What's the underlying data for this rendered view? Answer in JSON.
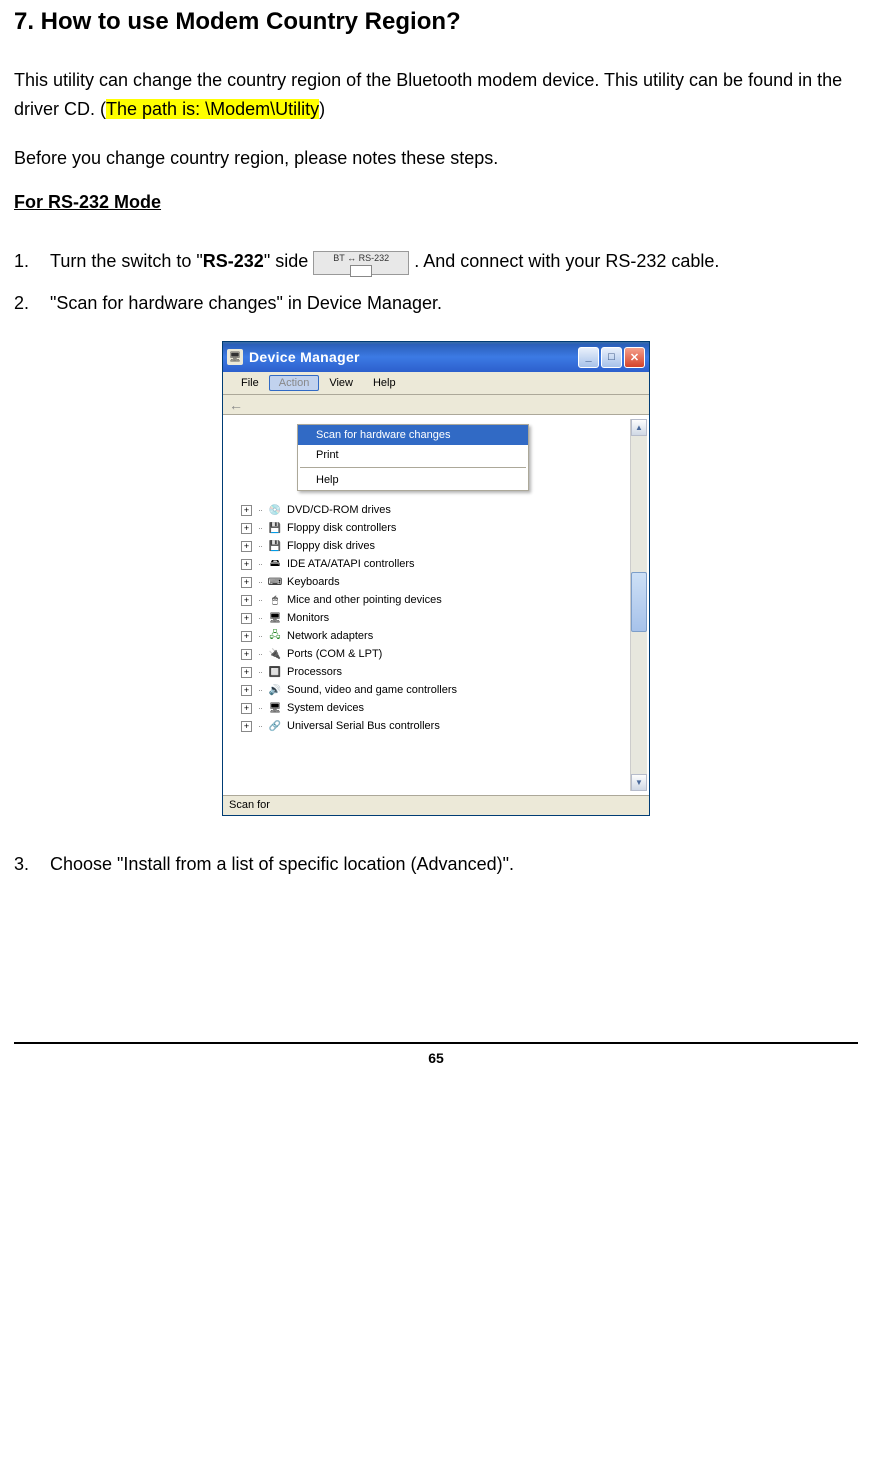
{
  "heading": "7. How to use Modem Country Region?",
  "para1_pre": "This utility can change the country region of the Bluetooth modem device. This utility can be found in the driver CD. (",
  "para1_hl": "The path is: \\Modem\\Utility",
  "para1_post": ")",
  "para2": "Before you change country region, please notes these steps.",
  "subheading": "For RS-232 Mode",
  "step1_a": "Turn the switch to \"",
  "step1_bold": "RS-232",
  "step1_b": "\" side ",
  "step1_c": ". And connect with your RS-232 cable.",
  "switch_icon_label": "BT ↔ RS-232",
  "step2": "\"Scan for hardware changes\" in Device Manager.",
  "step3": "Choose \"Install from a list of specific location (Advanced)\".",
  "devmgr": {
    "title": "Device Manager",
    "menus": {
      "file": "File",
      "action": "Action",
      "view": "View",
      "help": "Help"
    },
    "dropdown": {
      "scan": "Scan for hardware changes",
      "print": "Print",
      "help": "Help"
    },
    "tree": [
      "DVD/CD-ROM drives",
      "Floppy disk controllers",
      "Floppy disk drives",
      "IDE ATA/ATAPI controllers",
      "Keyboards",
      "Mice and other pointing devices",
      "Monitors",
      "Network adapters",
      "Ports (COM & LPT)",
      "Processors",
      "Sound, video and game controllers",
      "System devices",
      "Universal Serial Bus controllers"
    ],
    "status": "Scan for"
  },
  "page_number": "65"
}
